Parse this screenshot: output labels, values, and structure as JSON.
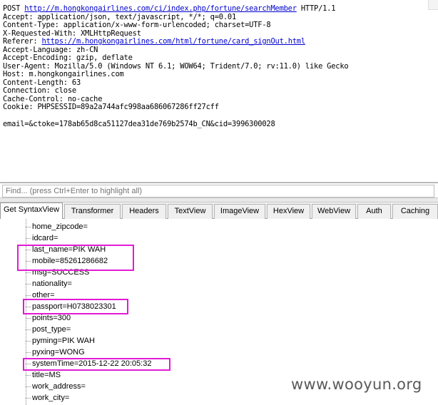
{
  "request": {
    "line1": {
      "method": "POST ",
      "url": "http://m.hongkongairlines.com/ci/index.php/fortune/searchMember",
      "protocol": " HTTP/1.1"
    },
    "accept": "Accept: application/json, text/javascript, */*; q=0.01",
    "content_type": "Content-Type: application/x-www-form-urlencoded; charset=UTF-8",
    "x_requested_with": "X-Requested-With: XMLHttpRequest",
    "referer_label": "Referer: ",
    "referer_url": "https://m.hongkongairlines.com/html/fortune/card_signOut.html",
    "accept_language": "Accept-Language: zh-CN",
    "accept_encoding": "Accept-Encoding: gzip, deflate",
    "user_agent": "User-Agent: Mozilla/5.0 (Windows NT 6.1; WOW64; Trident/7.0; rv:11.0) like Gecko",
    "host": "Host: m.hongkongairlines.com",
    "content_length": "Content-Length: 63",
    "connection": "Connection: close",
    "cache_control": "Cache-Control: no-cache",
    "cookie": "Cookie: PHPSESSID=89a2a744afc998aa686067286ff27cff",
    "body": "email=&ctoke=178ab65d8ca51127dea31de769b2574b_CN&cid=3996300028"
  },
  "find": {
    "placeholder": "Find... (press Ctrl+Enter to highlight all)"
  },
  "tabs": [
    {
      "label": "Get SyntaxView",
      "active": true
    },
    {
      "label": "Transformer"
    },
    {
      "label": "Headers"
    },
    {
      "label": "TextView"
    },
    {
      "label": "ImageView"
    },
    {
      "label": "HexView"
    },
    {
      "label": "WebView"
    },
    {
      "label": "Auth"
    },
    {
      "label": "Caching"
    }
  ],
  "tree_items": [
    "home_zipcode=",
    "idcard=",
    "last_name=PIK WAH",
    "mobile=85261286682",
    "msg=SUCCESS",
    "nationality=",
    "other=",
    "passport=H0738023301",
    "points=300",
    "post_type=",
    "pyming=PIK WAH",
    "pyxing=WONG",
    "systemTime=2015-12-22 20:05:32",
    "title=MS",
    "work_address=",
    "work_city="
  ],
  "highlight_color": "#e21bd6",
  "watermark": "www.wooyun.org"
}
